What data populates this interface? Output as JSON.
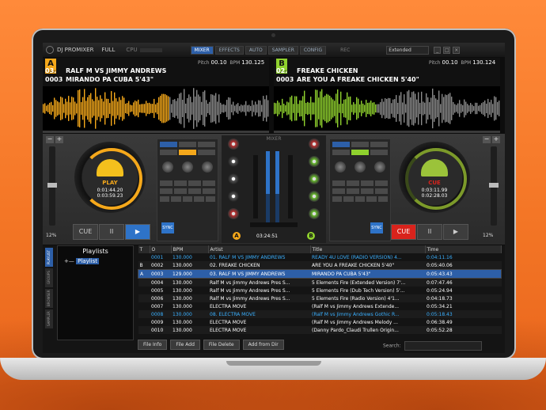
{
  "app": {
    "title": "DJ PROMIXER",
    "mode": "FULL",
    "cpu_label": "CPU",
    "rec_label": "REC"
  },
  "tabs": [
    "MIXER",
    "EFFECTS",
    "AUTO",
    "SAMPLER",
    "CONFIG"
  ],
  "skin_select": "Extended",
  "colors": {
    "deckA": "#f5a81b",
    "deckB": "#8fd12e",
    "accent": "#2d5fa8"
  },
  "deckA": {
    "letter": "A",
    "track_label": "TRACK",
    "pitch": "00.10",
    "bpm": "130.125",
    "line1_num": "03.",
    "line1_text": "RALF M VS JIMMY ANDREWS",
    "line2_num": "0003",
    "line2_text": "MIRANDO PA CUBA 5'43\"",
    "status": "PLAY",
    "time_elapsed": "0:01:44.20",
    "time_remain": "0:03:59.23",
    "pct": "12%",
    "cue": "CUE",
    "pause": "II",
    "play": "▶",
    "sync": "SYNC",
    "pitch_label": "Pitch",
    "bpm_label": "BPM"
  },
  "deckB": {
    "letter": "B",
    "track_label": "TRACK",
    "pitch": "00.10",
    "bpm": "130.124",
    "line1_num": "02.",
    "line1_text": "FREAKE CHICKEN",
    "line2_num": "0003",
    "line2_text": "ARE YOU A FREAKE CHICKEN 5'40\"",
    "status": "CUE",
    "time_elapsed": "0:03:11.99",
    "time_remain": "0:02:28.03",
    "pct": "12%",
    "cue": "CUE",
    "pause": "II",
    "play": "▶",
    "sync": "SYNC",
    "pitch_label": "Pitch",
    "bpm_label": "BPM"
  },
  "mixer": {
    "title": "MIXER",
    "time": "03:24:51",
    "a": "A",
    "b": "B"
  },
  "browser": {
    "vtabs": [
      "PLAYLIST",
      "GROUPS",
      "BROWSER",
      "SAMPLER"
    ],
    "playlists_title": "Playlists",
    "playlist_item": "Playlist",
    "columns": [
      "T",
      "O",
      "BPM",
      "Artist",
      "Title",
      "Time"
    ],
    "rows": [
      {
        "t": "",
        "o": "0001",
        "bpm": "130.000",
        "artist": "01. RALF M VS JIMMY ANDREWS",
        "title": "READY 4U LOVE (RADIO VERSION) 4...",
        "time": "0:04:11.16"
      },
      {
        "t": "B",
        "o": "0002",
        "bpm": "130.000",
        "artist": "02. FREAKE CHICKEN",
        "title": "ARE YOU A FREAKE CHICKEN 5'40\"",
        "time": "0:05:40.06"
      },
      {
        "t": "A",
        "o": "0003",
        "bpm": "129.000",
        "artist": "03. RALF M VS JIMMY ANDREWS",
        "title": "MIRANDO PA CUBA 5'43\"",
        "time": "0:05:43.43"
      },
      {
        "t": "",
        "o": "0004",
        "bpm": "130.000",
        "artist": "Ralf M vs Jimmy Andrews Pres S...",
        "title": "5 Elements Fire (Extended Version) 7'...",
        "time": "0:07:47.46"
      },
      {
        "t": "",
        "o": "0005",
        "bpm": "130.000",
        "artist": "Ralf M vs Jimmy Andrews Pres S...",
        "title": "5 Elements Fire (Dub Tech Version) 5'...",
        "time": "0:05:24.94"
      },
      {
        "t": "",
        "o": "0006",
        "bpm": "130.000",
        "artist": "Ralf M vs Jimmy Andrews Pres S...",
        "title": "5 Elements Fire (Radio Version) 4'1...",
        "time": "0:04:18.73"
      },
      {
        "t": "",
        "o": "0007",
        "bpm": "130.000",
        "artist": "ELECTRA MOVE",
        "title": "(Ralf M vs Jimmy Andrews Extende...",
        "time": "0:05:34.21"
      },
      {
        "t": "",
        "o": "0008",
        "bpm": "130.000",
        "artist": "08. ELECTRA MOVE",
        "title": "(Ralf M vs Jimmy Andrews Gothic R...",
        "time": "0:05:18.43"
      },
      {
        "t": "",
        "o": "0009",
        "bpm": "130.000",
        "artist": "ELECTRA MOVE",
        "title": "(Ralf M vs Jimmy Andrews Melody ...",
        "time": "0:06:38.49"
      },
      {
        "t": "",
        "o": "0010",
        "bpm": "130.000",
        "artist": "ELECTRA MOVE",
        "title": "(Danny Pardo_Claudi Trullen Origin...",
        "time": "0:05:52.28"
      }
    ],
    "buttons": [
      "File Info",
      "File Add",
      "File Delete",
      "Add from Dir"
    ],
    "search_label": "Search:"
  }
}
